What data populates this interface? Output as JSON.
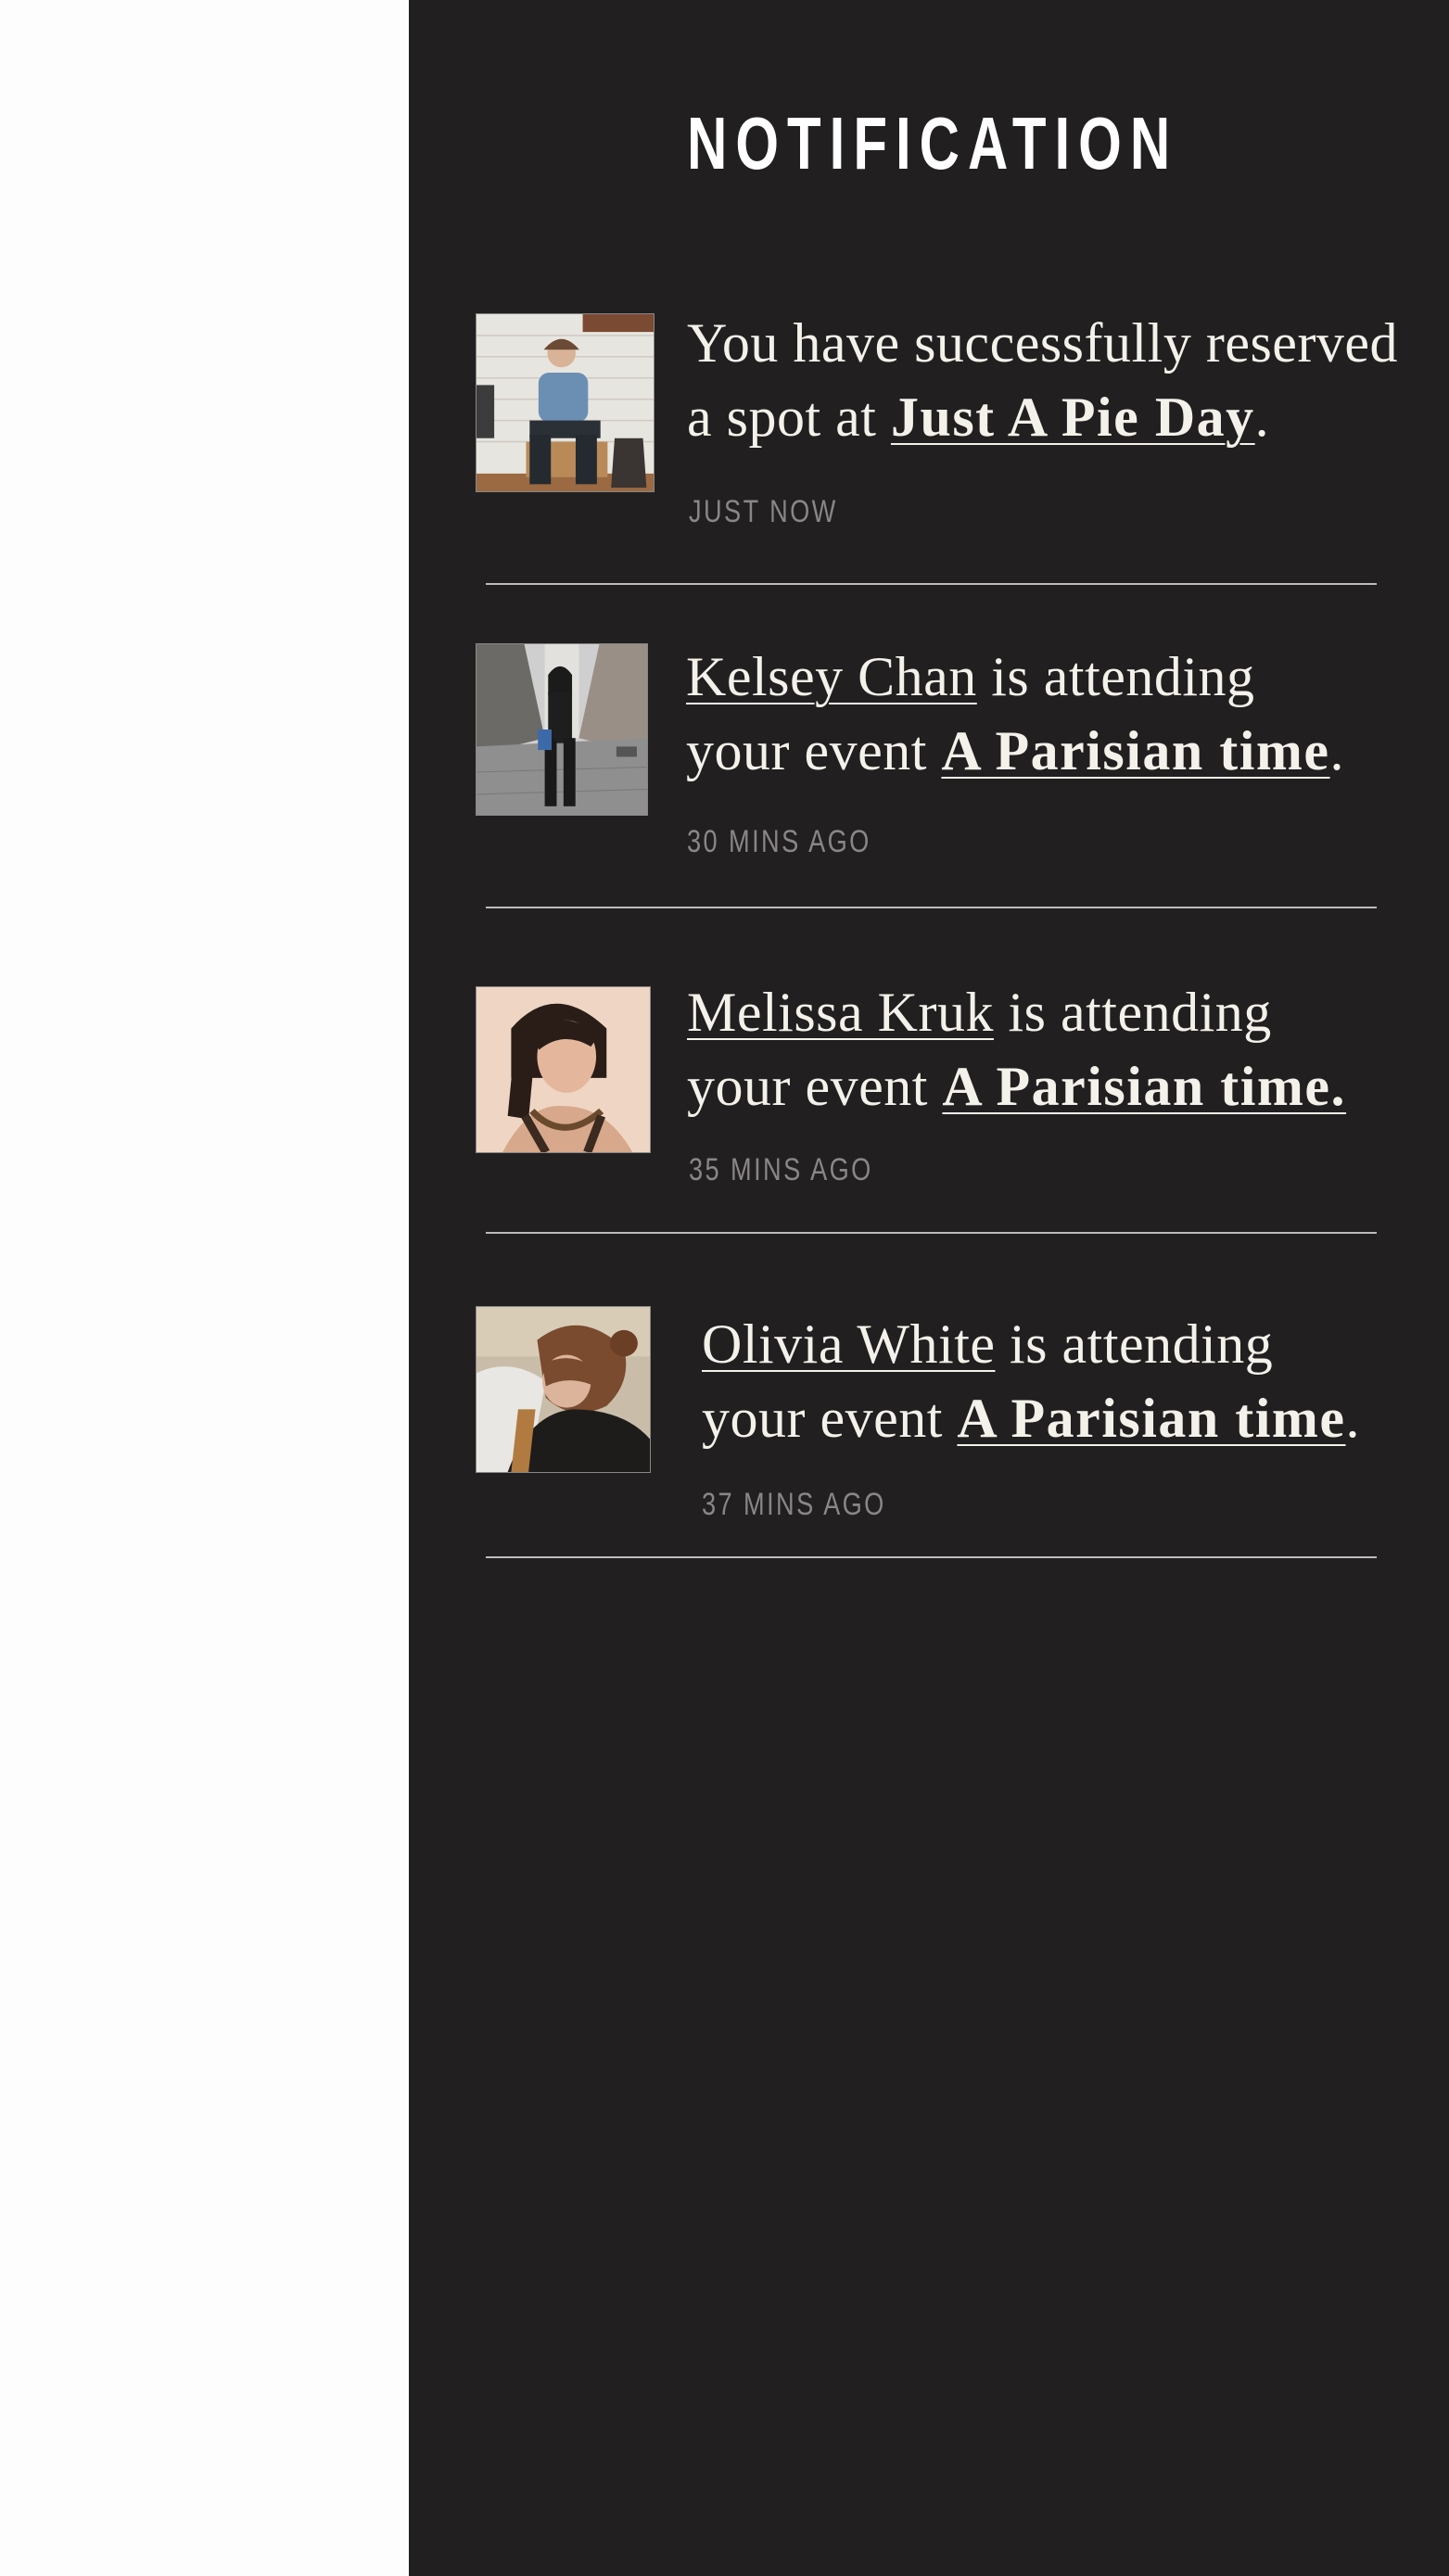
{
  "panel": {
    "title": "NOTIFICATION",
    "background_color": "#221f20"
  },
  "notifications": [
    {
      "avatar_icon": "man-sitting-avatar",
      "line1_text": "You have successfully reserved",
      "line2_prefix": "a spot at ",
      "event_name": "Just A Pie Day",
      "end_punct": ".",
      "time": "JUST NOW"
    },
    {
      "avatar_icon": "woman-street-avatar",
      "person_name": "Kelsey Chan",
      "attending_text": " is attending",
      "line2_prefix": "your event ",
      "event_name": "A Parisian time",
      "end_punct": ".",
      "time": "30 MINS AGO"
    },
    {
      "avatar_icon": "woman-portrait-avatar",
      "person_name": "Melissa Kruk",
      "attending_text": " is attending",
      "line2_prefix": "your event ",
      "event_name": "A Parisian time.",
      "end_punct": "",
      "time": "35 MINS AGO"
    },
    {
      "avatar_icon": "woman-beach-avatar",
      "person_name": "Olivia White",
      "attending_text": " is attending",
      "line2_prefix": "your event ",
      "event_name": "A Parisian time",
      "end_punct": ".",
      "time": "37 MINS AGO"
    }
  ]
}
